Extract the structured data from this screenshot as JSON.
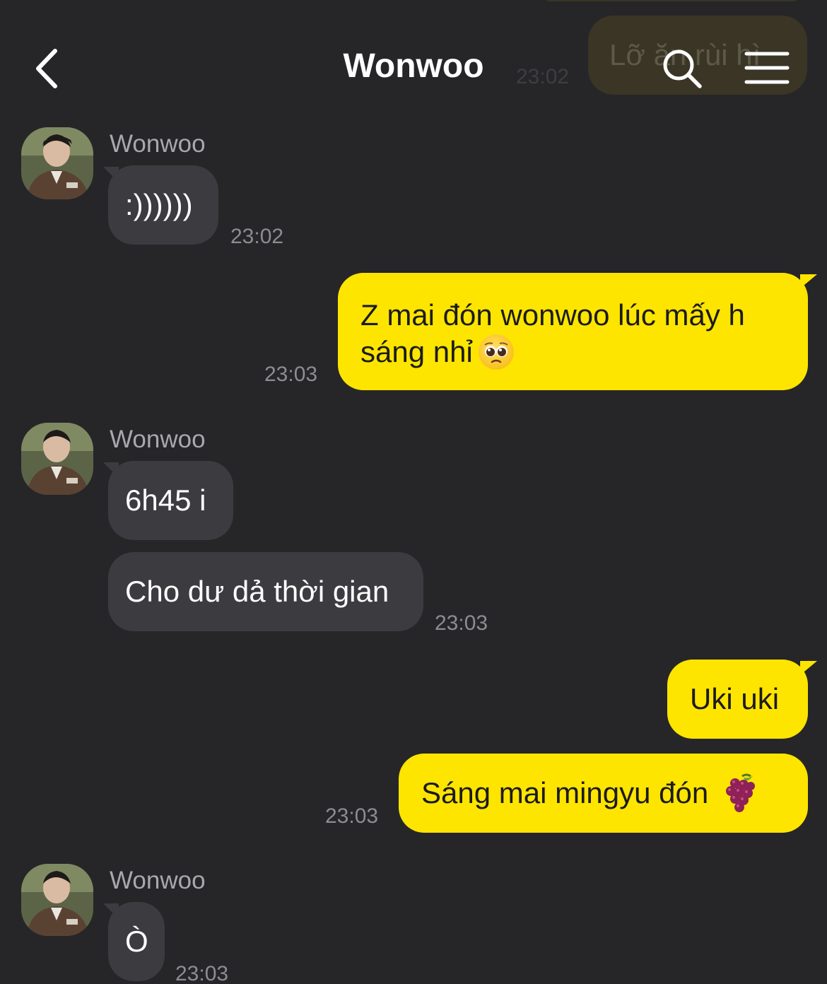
{
  "header": {
    "title": "Wonwoo",
    "faded_message": "Lỡ ăn rùi hì",
    "faded_time": "23:02"
  },
  "messages": [
    {
      "sender": "Wonwoo",
      "text": ":))))))",
      "time": "23:02"
    },
    {
      "text": "Z mai đón wonwoo lúc mấy h",
      "text2": "sáng nhỉ",
      "time": "23:03"
    },
    {
      "sender": "Wonwoo",
      "text": "6h45 i"
    },
    {
      "text": "Cho dư dả thời gian",
      "time": "23:03"
    },
    {
      "text": "Uki uki"
    },
    {
      "text": "Sáng mai mingyu đón",
      "time": "23:03"
    },
    {
      "sender": "Wonwoo",
      "text": "Ò",
      "time": "23:03"
    }
  ],
  "icons": {
    "back": "chevron-left-icon",
    "search": "search-icon",
    "menu": "hamburger-menu-icon",
    "pleading": "pleading-face-emoji",
    "grapes": "grapes-emoji"
  },
  "colors": {
    "background": "#262629",
    "incoming_bubble": "#3c3c40",
    "outgoing_bubble": "#fee500",
    "timestamp": "#8c8c91"
  }
}
